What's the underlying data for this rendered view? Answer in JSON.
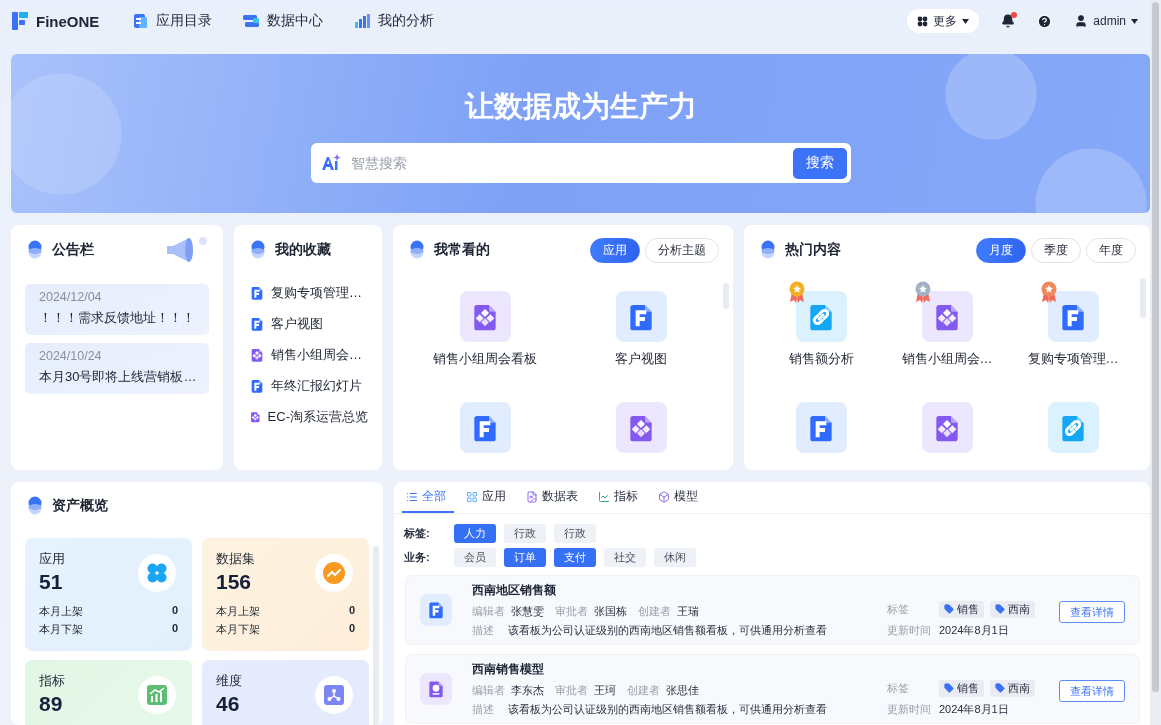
{
  "nav": {
    "logo": "FineONE",
    "links": [
      {
        "label": "应用目录",
        "kind": "catalog"
      },
      {
        "label": "数据中心",
        "kind": "data"
      },
      {
        "label": "我的分析",
        "kind": "analysis"
      }
    ],
    "more": "更多",
    "has_unread": true,
    "user": "admin"
  },
  "banner": {
    "title": "让数据成为生产力",
    "search_placeholder": "智慧搜索",
    "search_button": "搜索"
  },
  "notice": {
    "title": "公告栏",
    "items": [
      {
        "date": "2024/12/04",
        "text": "！！！需求反馈地址！！！"
      },
      {
        "date": "2024/10/24",
        "text": "本月30号即将上线营销板…"
      }
    ]
  },
  "favorites": {
    "title": "我的收藏",
    "items": [
      {
        "kind": "report",
        "label": "复购专项管理…"
      },
      {
        "kind": "report",
        "label": "客户视图"
      },
      {
        "kind": "dashboard",
        "label": "销售小组周会…"
      },
      {
        "kind": "report",
        "label": "年终汇报幻灯片"
      },
      {
        "kind": "dashboard",
        "label": "EC-淘系运营总览"
      }
    ]
  },
  "frequent": {
    "title": "我常看的",
    "toggles": [
      {
        "label": "应用",
        "selected": true
      },
      {
        "label": "分析主题",
        "selected": false
      }
    ],
    "items": [
      {
        "kind": "dashboard",
        "label": "销售小组周会看板"
      },
      {
        "kind": "report",
        "label": "客户视图"
      },
      {
        "kind": "report"
      },
      {
        "kind": "dashboard"
      }
    ]
  },
  "hot": {
    "title": "热门内容",
    "toggles": [
      {
        "label": "月度",
        "selected": true
      },
      {
        "label": "季度",
        "selected": false
      },
      {
        "label": "年度",
        "selected": false
      }
    ],
    "items": [
      {
        "kind": "link",
        "color": "#f5ae1f",
        "label": "销售额分析"
      },
      {
        "kind": "dashboard",
        "color": "#a3b1c4",
        "label": "销售小组周会…"
      },
      {
        "kind": "report",
        "color": "#f0885c",
        "label": "复购专项管理…"
      },
      {
        "kind": "report"
      },
      {
        "kind": "dashboard"
      },
      {
        "kind": "link"
      }
    ]
  },
  "assets": {
    "title": "资产概览",
    "cards": [
      {
        "kind": "app",
        "label": "应用",
        "count": "51",
        "stats": [
          {
            "label": "本月上架",
            "value": "0"
          },
          {
            "label": "本月下架",
            "value": "0"
          }
        ]
      },
      {
        "kind": "dataset",
        "label": "数据集",
        "count": "156",
        "stats": [
          {
            "label": "本月上架",
            "value": "0"
          },
          {
            "label": "本月下架",
            "value": "0"
          }
        ]
      },
      {
        "kind": "metric",
        "label": "指标",
        "count": "89"
      },
      {
        "kind": "dimension",
        "label": "维度",
        "count": "46"
      }
    ]
  },
  "catalog": {
    "tabs": [
      {
        "label": "全部",
        "kind": "all",
        "selected": true
      },
      {
        "label": "应用",
        "kind": "app",
        "selected": false
      },
      {
        "label": "数据表",
        "kind": "table",
        "selected": false
      },
      {
        "label": "指标",
        "kind": "metric",
        "selected": false
      },
      {
        "label": "模型",
        "kind": "model",
        "selected": false
      }
    ],
    "filters": [
      {
        "label": "标签:",
        "options": [
          {
            "label": "人力",
            "selected": true
          },
          {
            "label": "行政",
            "selected": false
          },
          {
            "label": "行政",
            "selected": false
          }
        ]
      },
      {
        "label": "业务:",
        "options": [
          {
            "label": "会员",
            "selected": false
          },
          {
            "label": "订单",
            "selected": true
          },
          {
            "label": "支付",
            "selected": true
          },
          {
            "label": "社交",
            "selected": false
          },
          {
            "label": "休闲",
            "selected": false
          }
        ]
      }
    ],
    "results": [
      {
        "kind": "report",
        "title": "西南地区销售额",
        "people": [
          {
            "role": "编辑者",
            "name": "张慧雯"
          },
          {
            "role": "审批者",
            "name": "张国栋"
          },
          {
            "role": "创建者",
            "name": "王瑞"
          }
        ],
        "desc_label": "描述",
        "desc": "该看板为公司认证级别的西南地区销售额看板，可供通用分析查看",
        "tags_label": "标签",
        "tags": [
          "销售",
          "西南"
        ],
        "updated_label": "更新时间",
        "updated": "2024年8月1日",
        "action": "查看详情"
      },
      {
        "kind": "model",
        "title": "西南销售模型",
        "people": [
          {
            "role": "编辑者",
            "name": "李东杰"
          },
          {
            "role": "审批者",
            "name": "王珂"
          },
          {
            "role": "创建者",
            "name": "张思佳"
          }
        ],
        "desc_label": "描述",
        "desc": "该看板为公司认证级别的西南地区销售额看板，可供通用分析查看",
        "tags_label": "标签",
        "tags": [
          "销售",
          "西南"
        ],
        "updated_label": "更新时间",
        "updated": "2024年8月1日",
        "action": "查看详情"
      }
    ]
  }
}
